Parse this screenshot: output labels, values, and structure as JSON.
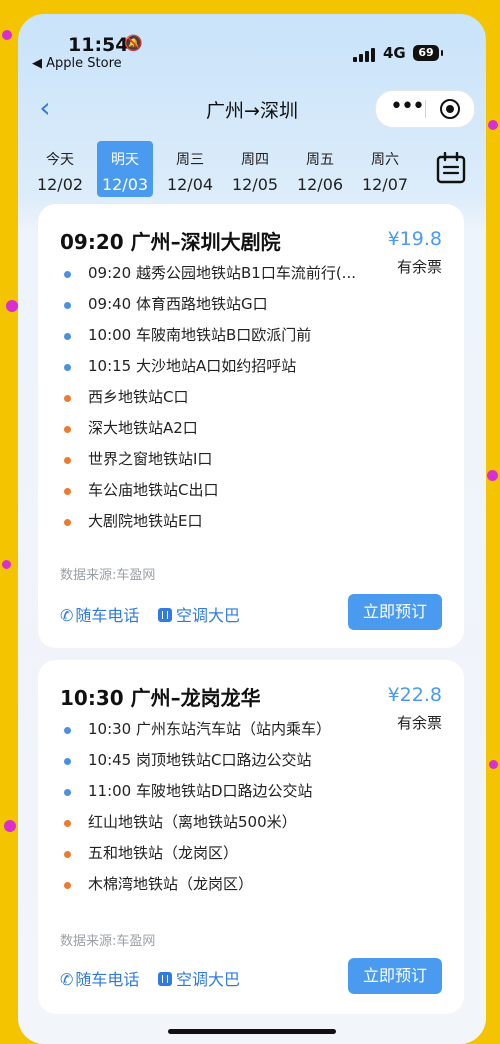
{
  "status_bar": {
    "time": "11:54",
    "back_app": "◀ Apple Store",
    "network": "4G",
    "battery": "69"
  },
  "nav": {
    "title": "广州→深圳"
  },
  "dates": [
    {
      "day": "今天",
      "date": "12/02",
      "active": false
    },
    {
      "day": "明天",
      "date": "12/03",
      "active": true
    },
    {
      "day": "周三",
      "date": "12/04",
      "active": false
    },
    {
      "day": "周四",
      "date": "12/05",
      "active": false
    },
    {
      "day": "周五",
      "date": "12/06",
      "active": false
    },
    {
      "day": "周六",
      "date": "12/07",
      "active": false
    }
  ],
  "colors": {
    "accent": "#4a9bf0",
    "link": "#2f7be0",
    "boarding_stop": "#4a90e2",
    "alighting_stop": "#ec7a2f"
  },
  "trips": [
    {
      "route": "09:20 广州–深圳大剧院",
      "price": "¥19.8",
      "availability": "有余票",
      "stops": [
        {
          "text": "09:20 越秀公园地铁站B1口车流前行(...",
          "type": "boarding"
        },
        {
          "text": "09:40 体育西路地铁站G口",
          "type": "boarding"
        },
        {
          "text": "10:00 车陂南地铁站B口欧派门前",
          "type": "boarding"
        },
        {
          "text": "10:15 大沙地站A口如约招呼站",
          "type": "boarding"
        },
        {
          "text": "西乡地铁站C口",
          "type": "alighting"
        },
        {
          "text": "深大地铁站A2口",
          "type": "alighting"
        },
        {
          "text": "世界之窗地铁站I口",
          "type": "alighting"
        },
        {
          "text": "车公庙地铁站C出口",
          "type": "alighting"
        },
        {
          "text": "大剧院地铁站E口",
          "type": "alighting"
        }
      ],
      "source": "数据来源:车盈网",
      "phone_label": "随车电话",
      "bus_label": "空调大巴",
      "book_label": "立即预订"
    },
    {
      "route": "10:30 广州–龙岗龙华",
      "price": "¥22.8",
      "availability": "有余票",
      "stops": [
        {
          "text": "10:30 广州东站汽车站（站内乘车）",
          "type": "boarding"
        },
        {
          "text": "10:45 岗顶地铁站C口路边公交站",
          "type": "boarding"
        },
        {
          "text": "11:00 车陂地铁站D口路边公交站",
          "type": "boarding"
        },
        {
          "text": "红山地铁站（离地铁站500米）",
          "type": "alighting"
        },
        {
          "text": "五和地铁站（龙岗区）",
          "type": "alighting"
        },
        {
          "text": "木棉湾地铁站（龙岗区）",
          "type": "alighting"
        }
      ],
      "source": "数据来源:车盈网",
      "phone_label": "随车电话",
      "bus_label": "空调大巴",
      "book_label": "立即预订"
    }
  ]
}
